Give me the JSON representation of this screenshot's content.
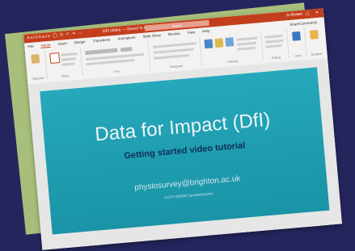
{
  "titlebar": {
    "quick_access": "AutoSave ◯ ⎘ ↶ ↷ ⋯",
    "document": "DFI slides — Saved to this PC",
    "search": "Search",
    "account": "Jo Brown",
    "window_buttons": "— ▢ ✕"
  },
  "tabs": [
    "File",
    "Home",
    "Insert",
    "Design",
    "Transitions",
    "Animations",
    "Slide Show",
    "Review",
    "View",
    "Help"
  ],
  "share_label": "Share",
  "comments_label": "Comments",
  "ribbon_groups": [
    "Clipboard",
    "Slides",
    "Font",
    "Paragraph",
    "Drawing",
    "Editing",
    "Voice",
    "Designer"
  ],
  "slide": {
    "title": "Data for Impact (DfI)",
    "subtitle": "Getting started video tutorial",
    "email": "physiosurvey@brighton.ac.uk",
    "phone": "01273 643092 (answerphone)"
  },
  "colors": {
    "background": "#25255e",
    "green_sheet": "#a7bf7a",
    "powerpoint_accent": "#c43e1c",
    "slide_teal": "#1d9db0",
    "subtitle": "#0f2d55"
  }
}
